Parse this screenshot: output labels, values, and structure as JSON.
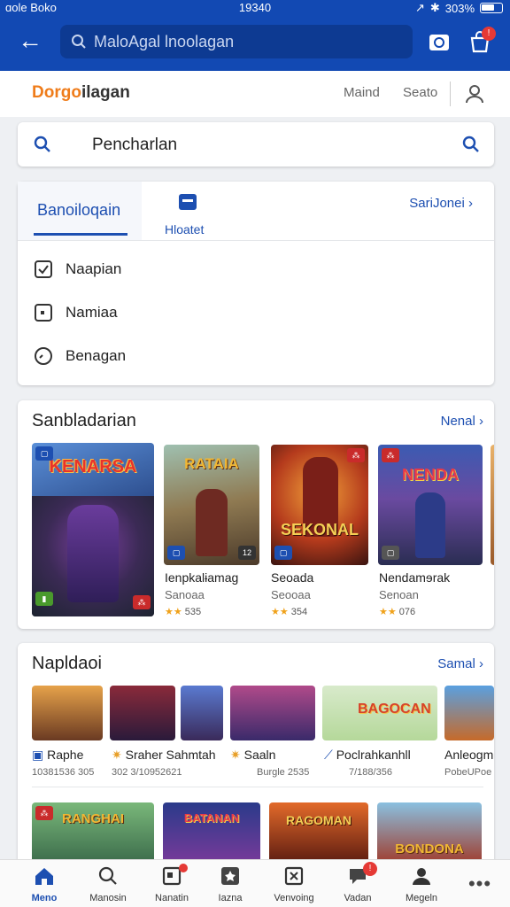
{
  "status": {
    "carrier": "ɑole Boko",
    "time": "19340",
    "battery": "303%"
  },
  "topbar": {
    "search_text": "MaloAgal lnoolagan"
  },
  "header": {
    "brand_prefix": "Dorgo",
    "brand_suffix": "ilagan",
    "link1": "Maind",
    "link2": "Seato"
  },
  "search": {
    "text": "Pencharlan"
  },
  "filter": {
    "active_tab": "Banoiloqain",
    "second_tab": "Hloatet",
    "more": "SariJonei",
    "options": [
      "Naapian",
      "Namiaa",
      "Benagan"
    ]
  },
  "section1": {
    "title": "Sanbladarian",
    "more": "Nenal",
    "games": [
      {
        "art": "KENARSA"
      },
      {
        "art": "RATAIA",
        "name": "Ienpkalɨamag",
        "sub": "Sanoaa",
        "rating": "535"
      },
      {
        "art": "SEKONAL",
        "name": "Seoada",
        "sub": "Seooaa",
        "rating": "354"
      },
      {
        "art": "NENDA",
        "name": "Nendamɘrak",
        "sub": "Senoan",
        "rating": "076"
      }
    ]
  },
  "section2": {
    "title": "Napldaoi",
    "more": "Samal",
    "games": [
      {
        "name": "Raphe",
        "sub": "10381536 305"
      },
      {
        "name": "Sraher Sahmtah",
        "sub": "302 3/10952621"
      },
      {
        "name": "Saaln",
        "sub": "Burgle 2535"
      },
      {
        "name": "Poclrahkanhll",
        "sub": "7/188/356",
        "art": "BAGOCAN"
      },
      {
        "name": "Anleogm",
        "sub": "PobeUPoe"
      }
    ],
    "row3": [
      "RANGHAI",
      "BATANAN",
      "RAGOMAN",
      "BONDONA"
    ]
  },
  "bottom_nav": {
    "items": [
      {
        "label": "Meno",
        "icon": "home-icon"
      },
      {
        "label": "Manosin",
        "icon": "search-icon"
      },
      {
        "label": "Nanatin",
        "icon": "apps-icon"
      },
      {
        "label": "Iazna",
        "icon": "puzzle-icon"
      },
      {
        "label": "Venvoing",
        "icon": "games-icon"
      },
      {
        "label": "Vadan",
        "icon": "chat-icon"
      },
      {
        "label": "Megeln",
        "icon": "account-icon"
      },
      {
        "label": "",
        "icon": "more-icon"
      }
    ]
  },
  "colors": {
    "primary": "#1249b3",
    "accent": "#1d4fb1",
    "badge": "#e53935",
    "star": "#f0a21b"
  }
}
